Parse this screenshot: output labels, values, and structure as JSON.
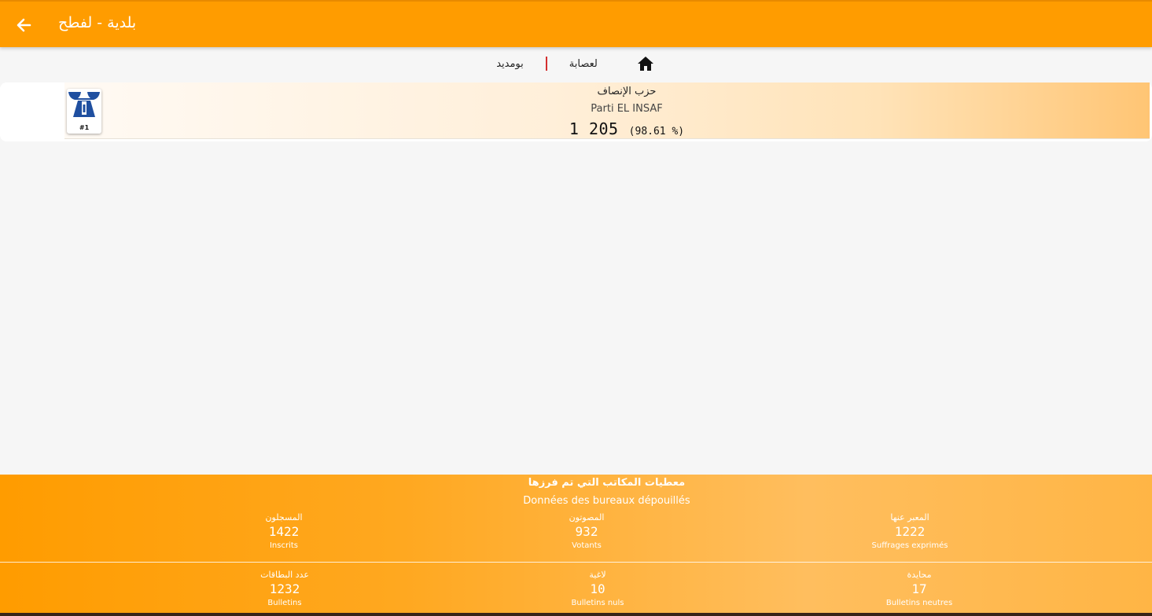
{
  "appbar": {
    "title": "بلدية - لفطح",
    "back_icon": "arrow-left-icon"
  },
  "breadcrumb": {
    "home_icon": "home-icon",
    "items": [
      {
        "label": "لعصابة"
      },
      {
        "label": "بومديد"
      }
    ]
  },
  "results": [
    {
      "rank": "#1",
      "name_ar": "حزب الإنصاف",
      "name_fr": "Parti EL INSAF",
      "votes": "1 205",
      "percent": "(98.61 %)"
    }
  ],
  "stats": {
    "title_ar": "معطيات المكاتب التي تم فرزها",
    "title_fr": "Données des bureaux dépouillés",
    "registered": {
      "label_ar": "المسجلون",
      "value": "1422",
      "label_fr": "Inscrits"
    },
    "voters": {
      "label_ar": "المصوتون",
      "value": "932",
      "label_fr": "Votants"
    },
    "expressed": {
      "label_ar": "المعبر عنها",
      "value": "1222",
      "label_fr": "Suffrages exprimés"
    },
    "ballots": {
      "label_ar": "عدد البطاقات",
      "value": "1232",
      "label_fr": "Bulletins"
    },
    "null_ballots": {
      "label_ar": "لاغية",
      "value": "10",
      "label_fr": "Bulletins nuls"
    },
    "neutral_ballots": {
      "label_ar": "محايدة",
      "value": "17",
      "label_fr": "Bulletins neutres"
    }
  },
  "colors": {
    "primary": "#ff9c00",
    "separator": "#d32f2f",
    "logo_blue": "#1f4fa0"
  }
}
